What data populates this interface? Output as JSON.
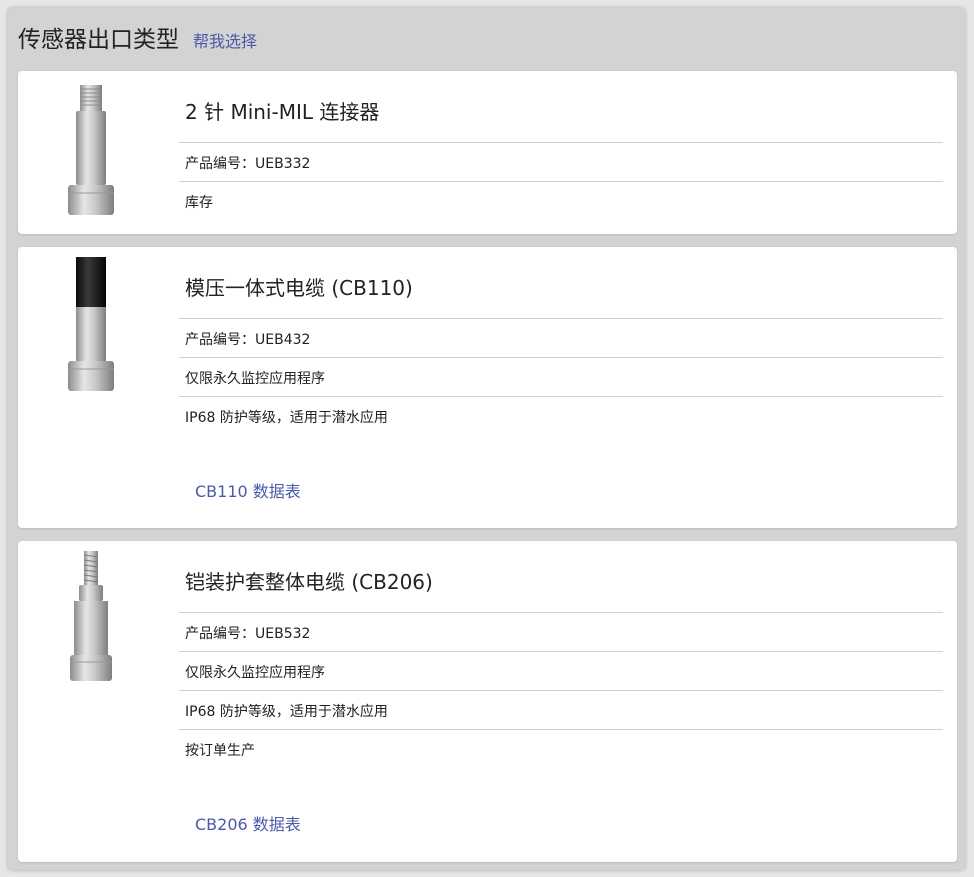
{
  "header": {
    "title": "传感器出口类型",
    "help_link": "帮我选择"
  },
  "products": [
    {
      "name": "2 针 Mini-MIL 连接器",
      "part_number": "产品编号：UEB332",
      "notes": [
        "库存"
      ],
      "datasheet": null
    },
    {
      "name": "模压一体式电缆 (CB110)",
      "part_number": "产品编号：UEB432",
      "notes": [
        "仅限永久监控应用程序",
        "IP68 防护等级，适用于潜水应用"
      ],
      "datasheet": "CB110 数据表"
    },
    {
      "name": "铠装护套整体电缆 (CB206)",
      "part_number": "产品编号：UEB532",
      "notes": [
        "仅限永久监控应用程序",
        "IP68 防护等级，适用于潜水应用",
        "按订单生产"
      ],
      "datasheet": "CB206 数据表"
    }
  ]
}
